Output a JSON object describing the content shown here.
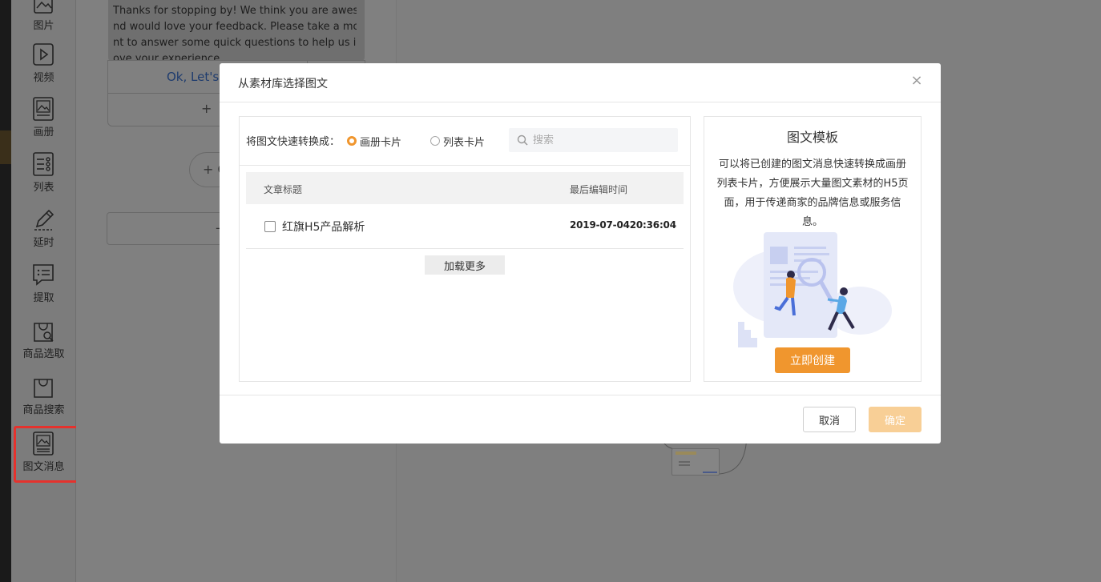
{
  "sidebar": {
    "items": [
      {
        "label": "图片",
        "icon": "image-icon"
      },
      {
        "label": "视频",
        "icon": "video-icon"
      },
      {
        "label": "画册",
        "icon": "album-icon"
      },
      {
        "label": "列表",
        "icon": "list-icon"
      },
      {
        "label": "延时",
        "icon": "pencil-icon"
      },
      {
        "label": "提取",
        "icon": "chat-list-icon"
      },
      {
        "label": "商品选取",
        "icon": "bag-search-icon"
      },
      {
        "label": "商品搜索",
        "icon": "bag-icon"
      },
      {
        "label": "图文消息",
        "icon": "article-icon"
      }
    ],
    "active_index": 8,
    "highlight_color": "#e5322d"
  },
  "chat": {
    "message_lines": [
      "Thanks for stopping by! We think you are awesome a",
      "nd would love your feedback. Please take a mome",
      "nt to answer some quick questions to help us impr",
      "ove your experience."
    ],
    "ok_button": "Ok, Let's s",
    "add_button": "+ ",
    "round_button": "+ C",
    "bar_button": "-"
  },
  "modal": {
    "title": "从素材库选择图文",
    "close": "×",
    "convert_label": "将图文快速转换成：",
    "radio_options": [
      {
        "label": "画册卡片",
        "checked": true
      },
      {
        "label": "列表卡片",
        "checked": false
      }
    ],
    "search": {
      "placeholder": "搜索",
      "value": ""
    },
    "table": {
      "headers": [
        "文章标题",
        "最后编辑时间"
      ],
      "rows": [
        {
          "title": "红旗H5产品解析",
          "time": "2019-07-0420:36:04",
          "checked": false
        }
      ]
    },
    "load_more": "加载更多",
    "template": {
      "title": "图文模板",
      "description": "可以将已创建的图文消息快速转换成画册列表卡片，方便展示大量图文素材的H5页面，用于传递商家的品牌信息或服务信息。",
      "create_button": "立即创建"
    },
    "cancel_button": "取消",
    "confirm_button": "确定",
    "accent_color": "#f0962e"
  }
}
